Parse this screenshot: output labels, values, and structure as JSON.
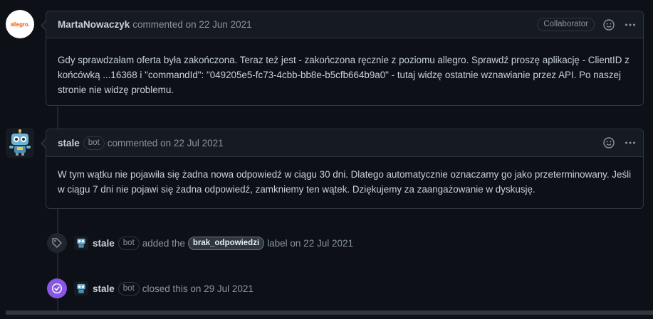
{
  "comments": [
    {
      "author": "MartaNowaczyk",
      "action": "commented on 22 Jun 2021",
      "avatar_text": "allegro.",
      "badge": "Collaborator",
      "body": "Gdy sprawdzałam oferta była zakończona. Teraz też jest - zakończona ręcznie z poziomu allegro. Sprawdź proszę aplikację - ClientID z końcówką ...16368 i \"commandId\": \"049205e5-fc73-4cbb-bb8e-b5cfb664b9a0\" - tutaj widzę ostatnie wznawianie przez API. Po naszej stronie nie widzę problemu."
    },
    {
      "author": "stale",
      "bot_label": "bot",
      "action": "commented on 22 Jul 2021",
      "body": "W tym wątku nie pojawiła się żadna nowa odpowiedź w ciągu 30 dni. Dlatego automatycznie oznaczamy go jako przeterminowany. Jeśli w ciągu 7 dni nie pojawi się żadna odpowiedź, zamkniemy ten wątek. Dziękujemy za zaangażowanie w dyskusję."
    }
  ],
  "events": [
    {
      "author": "stale",
      "bot_label": "bot",
      "prefix": "added the",
      "label": "brak_odpowiedzi",
      "suffix": "label on 22 Jul 2021",
      "icon": "tag-icon"
    },
    {
      "author": "stale",
      "bot_label": "bot",
      "text": "closed this on 29 Jul 2021",
      "icon": "check-circle-icon"
    }
  ],
  "colors": {
    "background": "#0d1117",
    "header": "#161b22",
    "border": "#30363d",
    "closed": "#8957e5",
    "allegro": "#ff5a00"
  }
}
